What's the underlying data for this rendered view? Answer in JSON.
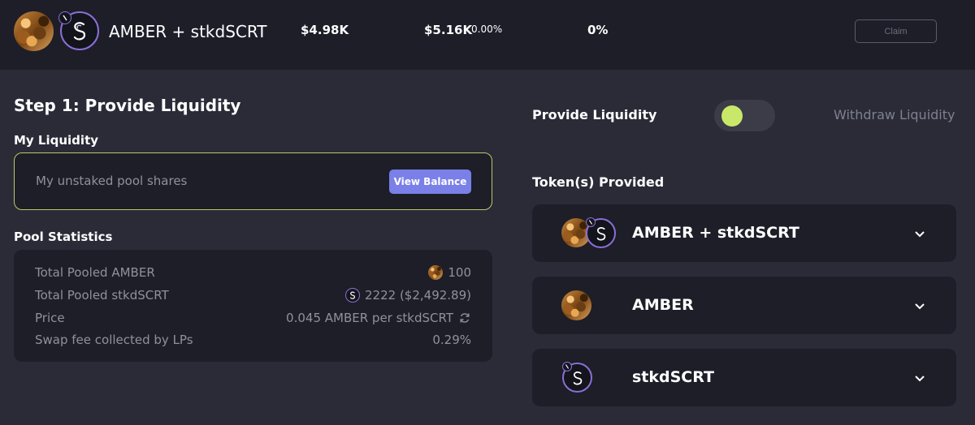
{
  "header": {
    "pair_name": "AMBER + stkdSCRT",
    "value_1": "$4.98K",
    "value_2": "$5.16K",
    "value_2_change": "0.00%",
    "value_3": "0%",
    "claim_label": "Claim"
  },
  "step": {
    "title": "Step 1: Provide Liquidity",
    "my_liquidity_title": "My Liquidity",
    "unstaked_label": "My unstaked pool shares",
    "view_balance_label": "View Balance"
  },
  "pool_stats": {
    "title": "Pool Statistics",
    "rows": [
      {
        "label": "Total Pooled AMBER",
        "value": "100",
        "icon": "amber-token-icon"
      },
      {
        "label": "Total Pooled stkdSCRT",
        "value": "2222 ($2,492.89)",
        "icon": "stkdscrt-token-icon"
      },
      {
        "label": "Price",
        "value": "0.045 AMBER per stkdSCRT",
        "icon": "swap-refresh-icon"
      },
      {
        "label": "Swap fee collected by LPs",
        "value": "0.29%",
        "icon": ""
      }
    ]
  },
  "liquidity_panel": {
    "provide_label": "Provide Liquidity",
    "withdraw_label": "Withdraw Liquidity",
    "tokens_provided_title": "Token(s) Provided",
    "tokens": [
      {
        "name": "AMBER + stkdSCRT"
      },
      {
        "name": "AMBER"
      },
      {
        "name": "stkdSCRT"
      }
    ]
  },
  "colors": {
    "background": "#2a2b37",
    "panel": "#1d1e28",
    "accent_button": "#7a80e8",
    "toggle_knob": "#c9e86a",
    "highlight_border": "#b9c96a"
  }
}
